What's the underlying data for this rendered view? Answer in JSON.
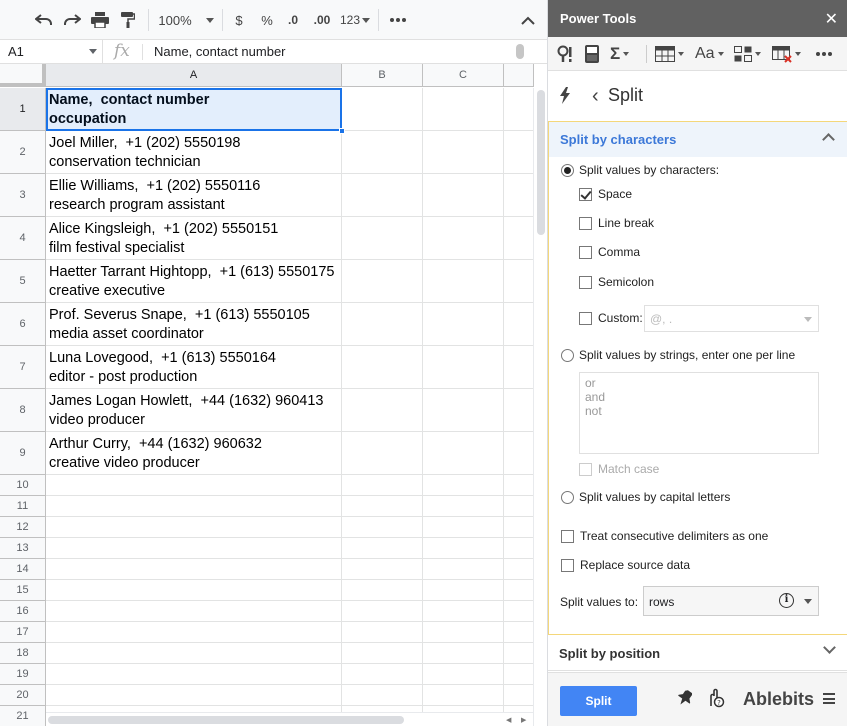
{
  "toolbar": {
    "zoom": "100%",
    "currency": "$",
    "percent": "%",
    "decrease_decimals": ".0",
    "increase_decimals": ".00",
    "more_formats": "123"
  },
  "formula_bar": {
    "cell_ref": "A1",
    "fx": "fx",
    "content": "Name,  contact number"
  },
  "grid": {
    "columns": [
      "A",
      "B",
      "C"
    ],
    "row_numbers": [
      "1",
      "2",
      "3",
      "4",
      "5",
      "6",
      "7",
      "8",
      "9",
      "10",
      "11",
      "12",
      "13",
      "14",
      "15",
      "16",
      "17",
      "18",
      "19",
      "20",
      "21"
    ],
    "cells": [
      "Name,  contact number\noccupation",
      "Joel Miller,  +1 (202) 5550198\nconservation technician",
      "Ellie Williams,  +1 (202) 5550116\nresearch program assistant",
      "Alice Kingsleigh,  +1 (202) 5550151\nfilm festival specialist",
      "Haetter Tarrant Hightopp,  +1 (613) 5550175\ncreative executive",
      "Prof. Severus Snape,  +1 (613) 5550105\nmedia asset coordinator",
      "Luna Lovegood,  +1 (613) 5550164\neditor - post production",
      "James Logan Howlett,  +44 (1632) 960413\nvideo producer",
      "Arthur Curry,  +44 (1632) 960632\ncreative video producer"
    ]
  },
  "panel": {
    "title": "Power Tools",
    "close": "✕",
    "font_tool": "Aa",
    "nav_title": "Split",
    "by_chars": {
      "title": "Split by characters",
      "radio_chars": "Split values by characters:",
      "space": "Space",
      "line_break": "Line break",
      "comma": "Comma",
      "semicolon": "Semicolon",
      "custom": "Custom:",
      "custom_placeholder": "@, .",
      "radio_strings": "Split values by strings, enter one per line",
      "strings_lines": [
        "or",
        "and",
        "not"
      ],
      "match_case": "Match case",
      "radio_capitals": "Split values by capital letters",
      "consecutive": "Treat consecutive delimiters as one",
      "replace_source": "Replace source data",
      "split_to_label": "Split values to:",
      "split_to_value": "rows"
    },
    "by_position_title": "Split by position",
    "footer": {
      "button": "Split",
      "brand": "Ablebits"
    }
  },
  "colors": {
    "accent": "#1a73e8",
    "section_title": "#3c78d8",
    "split_button": "#4285f4",
    "panel_header": "#616161",
    "section_border": "#f4d77a"
  }
}
